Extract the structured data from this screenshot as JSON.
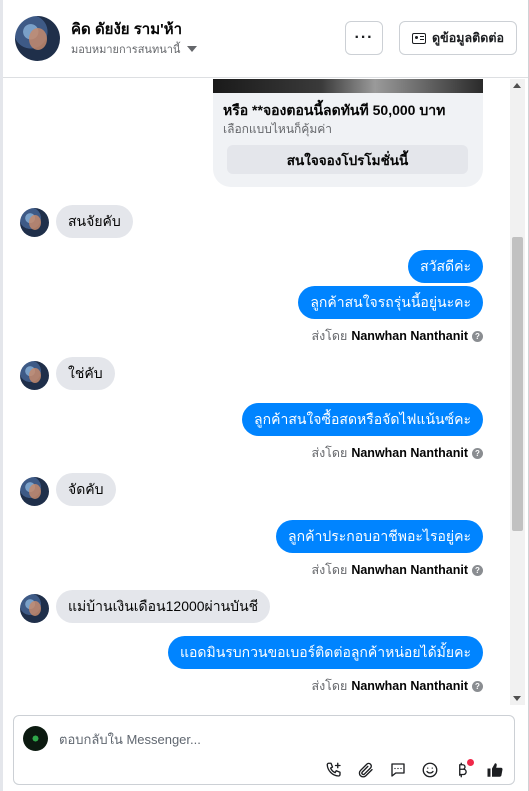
{
  "header": {
    "name": "คิด ดัยงัย ราม'ห้า",
    "subtitle": "มอบหมายการสนทนานี้",
    "more_label": "···",
    "contact_label": "ดูข้อมูลติดต่อ"
  },
  "promo": {
    "title": "หรือ **จองตอนนี้ลดทันที 50,000 บาท",
    "subtitle": "เลือกแบบไหนก็คุ้มค่า",
    "button": "สนใจจองโปรโมชั่นนี้"
  },
  "messages": {
    "m1": "สนจัยคับ",
    "m2": "สวัสดีค่ะ",
    "m3": "ลูกค้าสนใจรถรุ่นนี้อยู่นะคะ",
    "m4": "ใช่คับ",
    "m5": "ลูกค้าสนใจซื้อสดหรือจัดไฟแน้นซ์คะ",
    "m6": "จัดคับ",
    "m7": "ลูกค้าประกอบอาชีพอะไรอยู่คะ",
    "m8": "แม่บ้านเงินเดือน12000ผ่านบันชี",
    "m9": "แอดมินรบกวนขอเบอร์ติดต่อลูกค้าหน่อยได้มั้ยคะ"
  },
  "sent_by": {
    "prefix": "ส่งโดย",
    "agent": "Nanwhan Nanthanit",
    "help": "?"
  },
  "composer": {
    "placeholder": "ตอบกลับใน Messenger..."
  },
  "colors": {
    "outgoing_bubble": "#0084ff",
    "incoming_bubble": "#e4e6eb",
    "like_icon": "#1c1e21",
    "notification_dot": "#f02849"
  }
}
